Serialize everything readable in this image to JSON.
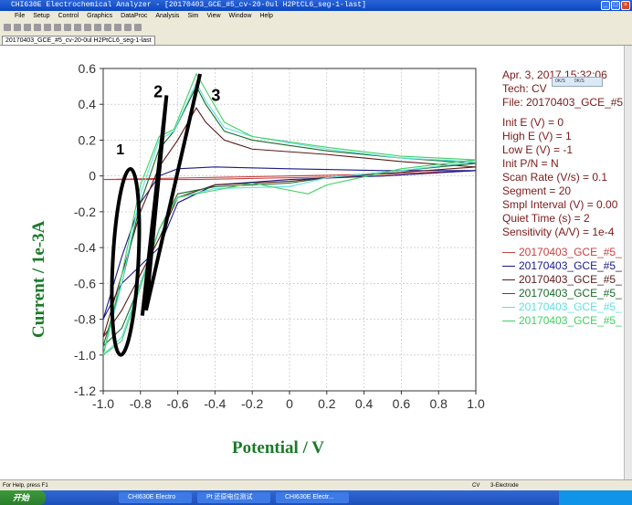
{
  "window": {
    "title": "CHI630E Electrochemical Analyzer - [20170403_GCE_#5_cv-20-0ul H2PtCL6_seg-1-last]"
  },
  "menu": [
    "File",
    "Setup",
    "Control",
    "Graphics",
    "DataProc",
    "Analysis",
    "Sim",
    "View",
    "Window",
    "Help"
  ],
  "tab": "20170403_GCE_#5_cv-20-0ul H2PtCL6_seg-1-last",
  "info": {
    "date": "Apr. 3, 2017   15:32:06",
    "tech": "Tech: CV",
    "file": "File: 20170403_GCE_#5",
    "params": [
      "Init E (V) = 0",
      "High E (V) = 1",
      "Low E (V) = -1",
      "Init P/N = N",
      "Scan Rate (V/s) = 0.1",
      "Segment = 20",
      "Smpl Interval (V) = 0.00",
      "Quiet Time (s) = 2",
      "Sensitivity (A/V) = 1e-4"
    ]
  },
  "minibar": [
    "0K/S",
    "0K/S"
  ],
  "status": {
    "help": "For Help, press F1",
    "mode": "CV",
    "electrode": "3-Electrode"
  },
  "taskbar": {
    "start": "开始",
    "tasks": [
      "CHI630E Electro",
      "Pt 还原电位测试",
      "CHI630E Electr..."
    ]
  },
  "annotations": [
    "1",
    "2",
    "3"
  ],
  "chart_data": {
    "type": "line",
    "xlabel": "Potential / V",
    "ylabel": "Current / 1e-3A",
    "xlim": [
      -1.0,
      1.0
    ],
    "ylim": [
      -1.2,
      0.6
    ],
    "xticks": [
      "-1.0",
      "-0.8",
      "-0.6",
      "-0.4",
      "-0.2",
      "0",
      "0.2",
      "0.4",
      "0.6",
      "0.8",
      "1.0"
    ],
    "yticks": [
      "0.6",
      "0.4",
      "0.2",
      "0",
      "-0.2",
      "-0.4",
      "-0.6",
      "-0.8",
      "-1.0",
      "-1.2"
    ],
    "series": [
      {
        "name": "20170403_GCE_#5_",
        "color": "#c84040",
        "points": [
          [
            -1,
            -0.02
          ],
          [
            -0.5,
            -0.01
          ],
          [
            0,
            0.0
          ],
          [
            0.5,
            0.01
          ],
          [
            1,
            0.03
          ],
          [
            0.5,
            0.0
          ],
          [
            0,
            -0.01
          ],
          [
            -0.5,
            -0.02
          ],
          [
            -1,
            -0.02
          ]
        ]
      },
      {
        "name": "20170403_GCE_#5_",
        "color": "#1a1a8a",
        "points": [
          [
            -1,
            -0.8
          ],
          [
            -0.9,
            -0.45
          ],
          [
            -0.8,
            -0.15
          ],
          [
            -0.7,
            0.0
          ],
          [
            -0.6,
            0.04
          ],
          [
            -0.4,
            0.05
          ],
          [
            0,
            0.04
          ],
          [
            0.5,
            0.03
          ],
          [
            1,
            0.03
          ],
          [
            0.5,
            0.0
          ],
          [
            0,
            -0.02
          ],
          [
            -0.4,
            -0.05
          ],
          [
            -0.6,
            -0.15
          ],
          [
            -0.7,
            -0.4
          ],
          [
            -0.8,
            -0.5
          ],
          [
            -0.9,
            -0.6
          ],
          [
            -1,
            -0.8
          ]
        ]
      },
      {
        "name": "20170403_GCE_#5_",
        "color": "#5a1a1a",
        "points": [
          [
            -1,
            -0.9
          ],
          [
            -0.9,
            -0.55
          ],
          [
            -0.8,
            -0.2
          ],
          [
            -0.7,
            0.05
          ],
          [
            -0.6,
            0.2
          ],
          [
            -0.5,
            0.38
          ],
          [
            -0.45,
            0.3
          ],
          [
            -0.35,
            0.2
          ],
          [
            -0.2,
            0.15
          ],
          [
            0.2,
            0.12
          ],
          [
            0.6,
            0.08
          ],
          [
            1,
            0.05
          ],
          [
            0.6,
            0.02
          ],
          [
            0.2,
            -0.01
          ],
          [
            0,
            -0.03
          ],
          [
            -0.4,
            -0.05
          ],
          [
            -0.6,
            -0.12
          ],
          [
            -0.7,
            -0.35
          ],
          [
            -0.8,
            -0.55
          ],
          [
            -0.9,
            -0.75
          ],
          [
            -1,
            -0.9
          ]
        ]
      },
      {
        "name": "20170403_GCE_#5_",
        "color": "#1a6a2a",
        "points": [
          [
            -1,
            -0.95
          ],
          [
            -0.9,
            -0.6
          ],
          [
            -0.8,
            -0.15
          ],
          [
            -0.7,
            0.15
          ],
          [
            -0.62,
            0.25
          ],
          [
            -0.5,
            0.5
          ],
          [
            -0.45,
            0.4
          ],
          [
            -0.35,
            0.25
          ],
          [
            -0.2,
            0.2
          ],
          [
            0.2,
            0.14
          ],
          [
            0.6,
            0.1
          ],
          [
            1,
            0.07
          ],
          [
            0.6,
            0.03
          ],
          [
            0.2,
            -0.01
          ],
          [
            0,
            -0.04
          ],
          [
            -0.4,
            -0.06
          ],
          [
            -0.6,
            -0.1
          ],
          [
            -0.7,
            -0.3
          ],
          [
            -0.8,
            -0.6
          ],
          [
            -0.9,
            -0.85
          ],
          [
            -1,
            -0.95
          ]
        ]
      },
      {
        "name": "20170403_GCE_#5_",
        "color": "#60e0e0",
        "points": [
          [
            -1,
            -1.0
          ],
          [
            -0.9,
            -0.6
          ],
          [
            -0.8,
            -0.1
          ],
          [
            -0.7,
            0.2
          ],
          [
            -0.62,
            0.25
          ],
          [
            -0.5,
            0.52
          ],
          [
            -0.45,
            0.42
          ],
          [
            -0.35,
            0.27
          ],
          [
            -0.2,
            0.22
          ],
          [
            0.2,
            0.15
          ],
          [
            0.6,
            0.1
          ],
          [
            1,
            0.08
          ],
          [
            0.6,
            0.03
          ],
          [
            0.2,
            -0.01
          ],
          [
            0,
            -0.06
          ],
          [
            -0.4,
            -0.07
          ],
          [
            -0.6,
            -0.12
          ],
          [
            -0.7,
            -0.3
          ],
          [
            -0.8,
            -0.6
          ],
          [
            -0.9,
            -0.9
          ],
          [
            -1,
            -1.0
          ]
        ]
      },
      {
        "name": "20170403_GCE_#5_",
        "color": "#40d060",
        "points": [
          [
            -1,
            -1.0
          ],
          [
            -0.9,
            -0.55
          ],
          [
            -0.8,
            -0.05
          ],
          [
            -0.7,
            0.22
          ],
          [
            -0.62,
            0.26
          ],
          [
            -0.5,
            0.57
          ],
          [
            -0.45,
            0.48
          ],
          [
            -0.35,
            0.3
          ],
          [
            -0.2,
            0.22
          ],
          [
            0.2,
            0.16
          ],
          [
            0.6,
            0.11
          ],
          [
            1,
            0.09
          ],
          [
            0.6,
            0.04
          ],
          [
            0.2,
            -0.05
          ],
          [
            0.1,
            -0.1
          ],
          [
            0,
            -0.08
          ],
          [
            -0.2,
            -0.04
          ],
          [
            -0.4,
            -0.08
          ],
          [
            -0.6,
            -0.12
          ],
          [
            -0.7,
            -0.3
          ],
          [
            -0.8,
            -0.62
          ],
          [
            -0.9,
            -0.92
          ],
          [
            -1,
            -1.0
          ]
        ]
      }
    ]
  }
}
